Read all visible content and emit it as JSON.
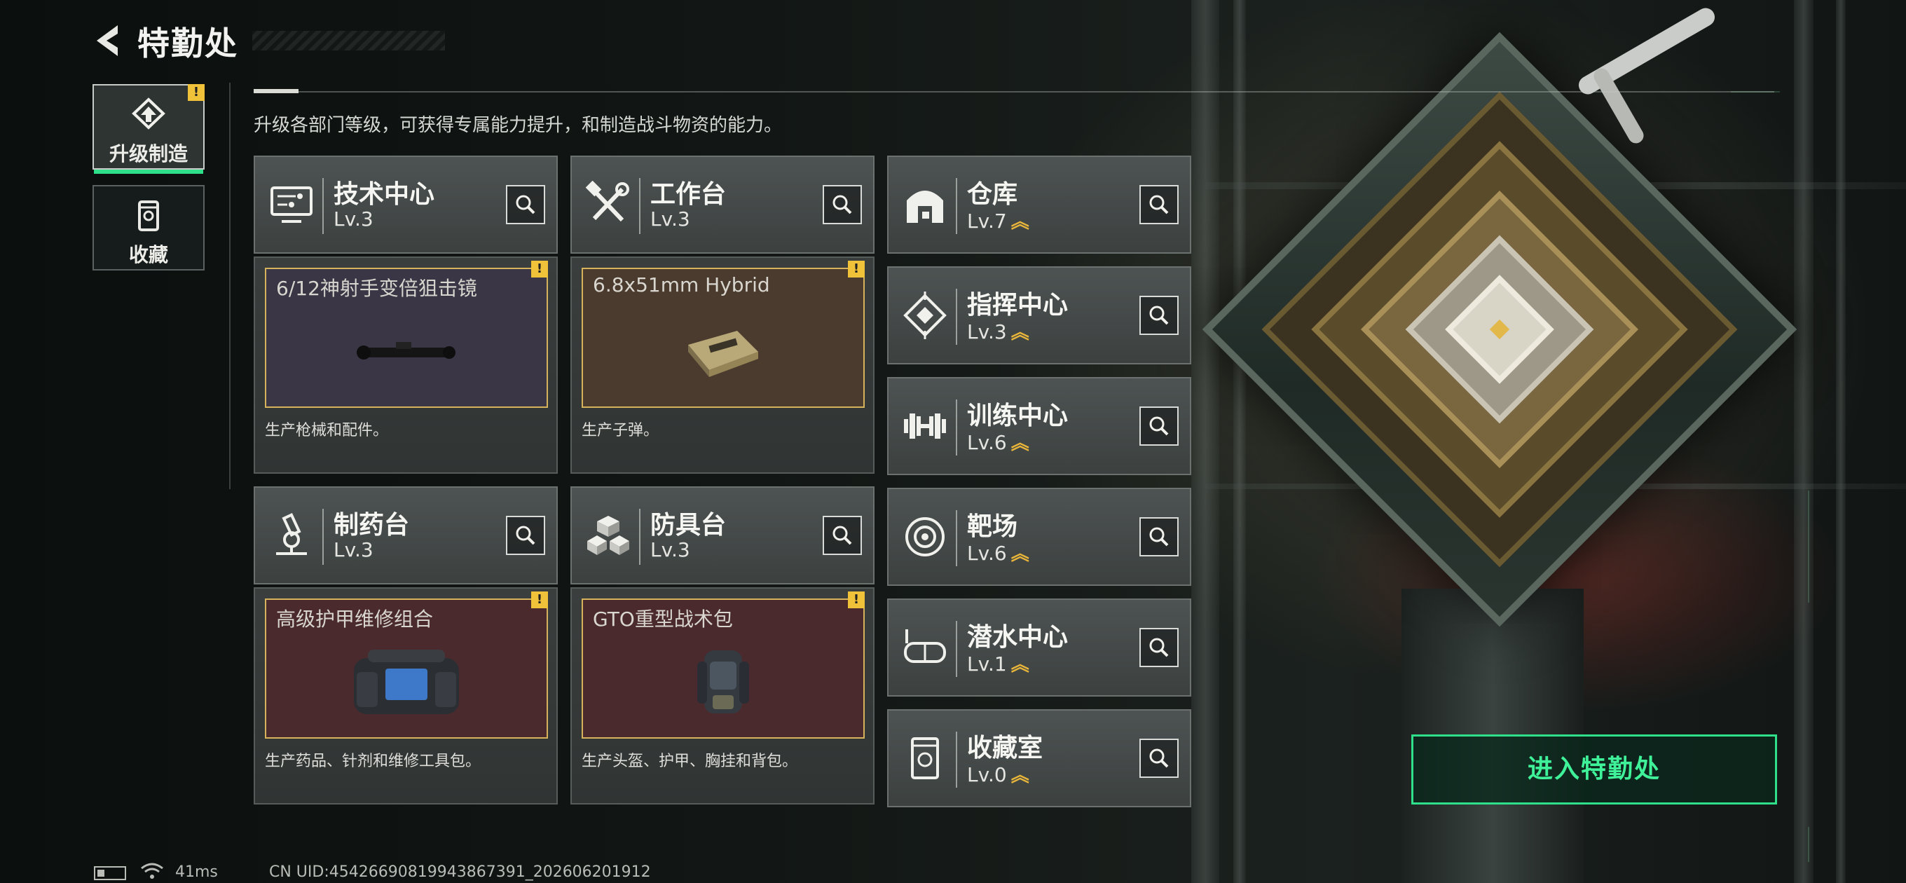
{
  "header": {
    "title": "特勤处"
  },
  "tabs": [
    {
      "label": "升级制造",
      "active": true,
      "alert": "!"
    },
    {
      "label": "收藏",
      "active": false
    }
  ],
  "subtitle": "升级各部门等级，可获得专属能力提升，和制造战斗物资的能力。",
  "departments": {
    "tech": {
      "name": "技术中心",
      "level": "Lv.3",
      "icon": "monitor-icon"
    },
    "workbench": {
      "name": "工作台",
      "level": "Lv.3",
      "icon": "tools-icon"
    },
    "pharmacy": {
      "name": "制药台",
      "level": "Lv.3",
      "icon": "microscope-icon"
    },
    "armor": {
      "name": "防具台",
      "level": "Lv.3",
      "icon": "cubes-icon"
    },
    "warehouse": {
      "name": "仓库",
      "level": "Lv.7",
      "icon": "warehouse-icon"
    },
    "command": {
      "name": "指挥中心",
      "level": "Lv.3",
      "icon": "command-icon"
    },
    "training": {
      "name": "训练中心",
      "level": "Lv.6",
      "icon": "dumbbell-icon"
    },
    "range": {
      "name": "靶场",
      "level": "Lv.6",
      "icon": "target-icon"
    },
    "diving": {
      "name": "潜水中心",
      "level": "Lv.1",
      "icon": "diving-mask-icon"
    },
    "collection": {
      "name": "收藏室",
      "level": "Lv.0",
      "icon": "collection-icon"
    }
  },
  "products": {
    "tech": {
      "name": "6/12神射手变倍狙击镜",
      "desc": "生产枪械和配件。",
      "bg": "#3a3646"
    },
    "workbench": {
      "name": "6.8x51mm Hybrid",
      "desc": "生产子弹。",
      "bg": "#4a3b2e"
    },
    "pharmacy": {
      "name": "高级护甲维修组合",
      "desc": "生产药品、针剂和维修工具包。",
      "bg": "#4a2a2c"
    },
    "armor": {
      "name": "GTO重型战术包",
      "desc": "生产头盔、护甲、胸挂和背包。",
      "bg": "#4a2a2c"
    }
  },
  "alert_mark": "!",
  "level_chevron": "︽",
  "enter_button": "进入特勤处",
  "status": {
    "ping": "41ms",
    "uid": "CN UID:4542669081994386739​1_202606201912"
  },
  "colors": {
    "accent": "#2fe08a",
    "alert": "#f0c23a",
    "product_border": "#d6b25a"
  }
}
